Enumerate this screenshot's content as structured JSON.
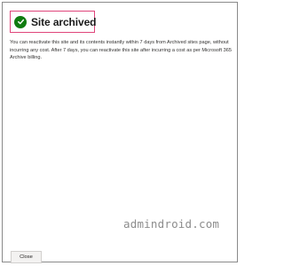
{
  "dialog": {
    "title": "Site archived",
    "message": "You can reactivate this site and its contents instantly within 7 days from Archived sites page, without incurring any cost. After 7 days, you can reactivate this site after incurring a cost as per Microsoft 365 Archive billing.",
    "close_label": "Close",
    "status_icon": "check-circle-icon",
    "colors": {
      "success": "#107c10",
      "highlight_border": "#e0457b"
    }
  },
  "watermark": {
    "text": "admindroid.com"
  }
}
